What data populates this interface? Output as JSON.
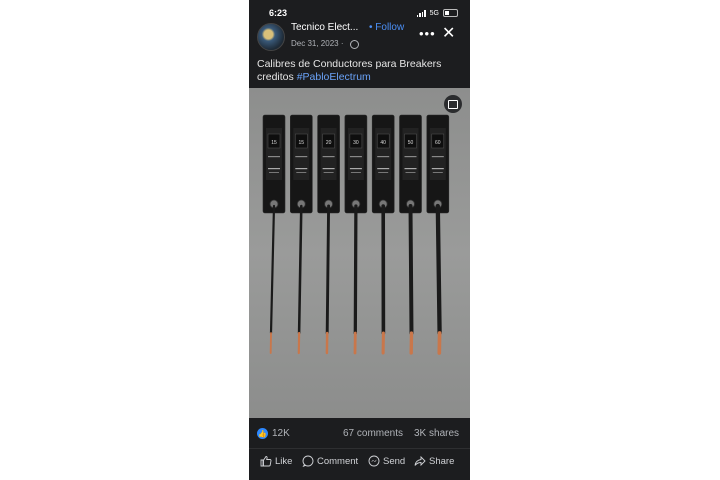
{
  "status_bar": {
    "time": "6:23",
    "network": "5G"
  },
  "post": {
    "page_name": "Tecnico Elect...",
    "follow": "• Follow",
    "date": "Dec 31, 2023 ·",
    "caption_text": "Calibres de Conductores para Breakers creditos ",
    "hashtag": "#PabloElectrum"
  },
  "photo": {
    "breaker_ratings": [
      "15",
      "15",
      "20",
      "30",
      "40",
      "50",
      "60"
    ],
    "wire_color": "#1a1a1a",
    "copper_color": "#c9774b"
  },
  "stats": {
    "likes": "12K",
    "comments": "67 comments",
    "shares": "3K shares"
  },
  "actions": {
    "like": "Like",
    "comment": "Comment",
    "send": "Send",
    "share": "Share"
  },
  "colors": {
    "accent": "#4b8ff5",
    "background": "#1c1d1f",
    "like_badge": "#2d88ff"
  }
}
